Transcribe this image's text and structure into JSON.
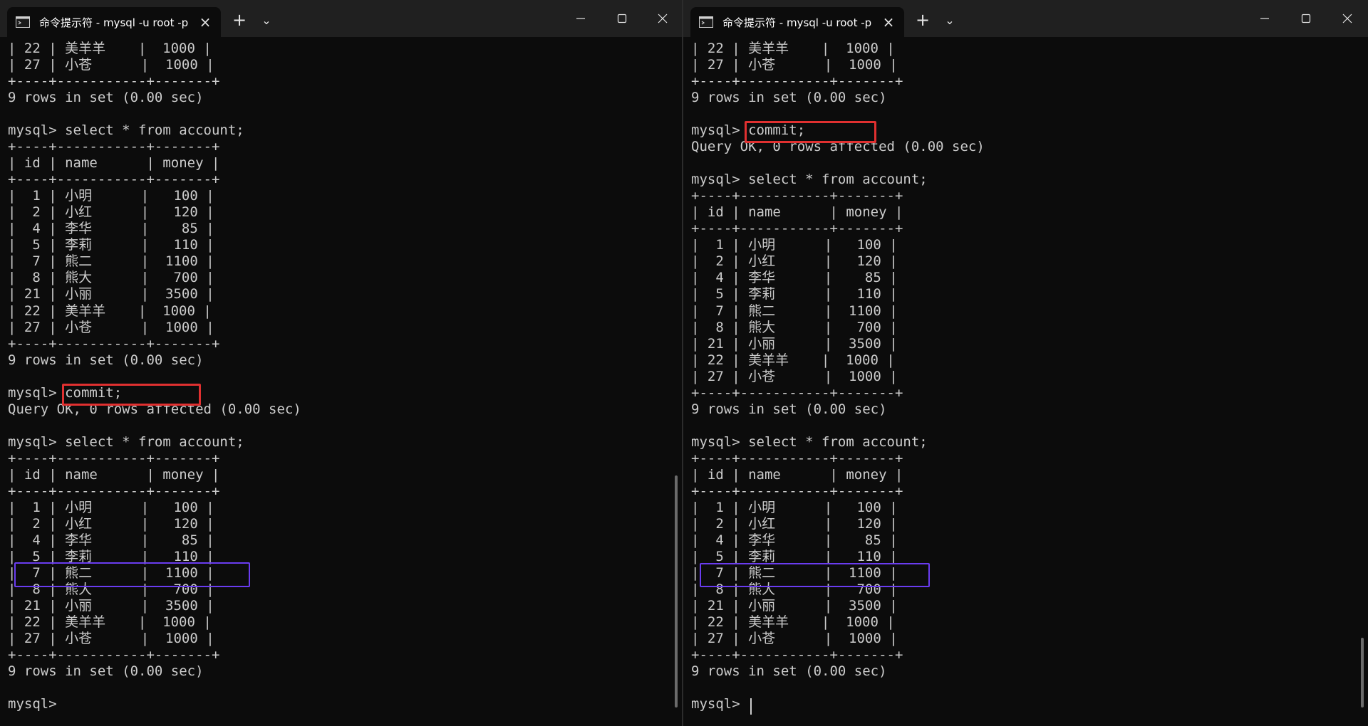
{
  "left": {
    "tab_title": "命令提示符 - mysql  -u root -p",
    "lines": [
      "| 22 | 美羊羊    |  1000 |",
      "| 27 | 小苍      |  1000 |",
      "+----+-----------+-------+",
      "9 rows in set (0.00 sec)",
      "",
      "mysql> select * from account;",
      "+----+-----------+-------+",
      "| id | name      | money |",
      "+----+-----------+-------+",
      "|  1 | 小明      |   100 |",
      "|  2 | 小红      |   120 |",
      "|  4 | 李华      |    85 |",
      "|  5 | 李莉      |   110 |",
      "|  7 | 熊二      |  1100 |",
      "|  8 | 熊大      |   700 |",
      "| 21 | 小丽      |  3500 |",
      "| 22 | 美羊羊    |  1000 |",
      "| 27 | 小苍      |  1000 |",
      "+----+-----------+-------+",
      "9 rows in set (0.00 sec)",
      "",
      "mysql> commit;",
      "Query OK, 0 rows affected (0.00 sec)",
      "",
      "mysql> select * from account;",
      "+----+-----------+-------+",
      "| id | name      | money |",
      "+----+-----------+-------+",
      "|  1 | 小明      |   100 |",
      "|  2 | 小红      |   120 |",
      "|  4 | 李华      |    85 |",
      "|  5 | 李莉      |   110 |",
      "|  7 | 熊二      |  1100 |",
      "|  8 | 熊大      |   700 |",
      "| 21 | 小丽      |  3500 |",
      "| 22 | 美羊羊    |  1000 |",
      "| 27 | 小苍      |  1000 |",
      "+----+-----------+-------+",
      "9 rows in set (0.00 sec)",
      "",
      "mysql> "
    ]
  },
  "right": {
    "tab_title": "命令提示符 - mysql  -u root -p",
    "lines": [
      "| 22 | 美羊羊    |  1000 |",
      "| 27 | 小苍      |  1000 |",
      "+----+-----------+-------+",
      "9 rows in set (0.00 sec)",
      "",
      "mysql> commit;",
      "Query OK, 0 rows affected (0.00 sec)",
      "",
      "mysql> select * from account;",
      "+----+-----------+-------+",
      "| id | name      | money |",
      "+----+-----------+-------+",
      "|  1 | 小明      |   100 |",
      "|  2 | 小红      |   120 |",
      "|  4 | 李华      |    85 |",
      "|  5 | 李莉      |   110 |",
      "|  7 | 熊二      |  1100 |",
      "|  8 | 熊大      |   700 |",
      "| 21 | 小丽      |  3500 |",
      "| 22 | 美羊羊    |  1000 |",
      "| 27 | 小苍      |  1000 |",
      "+----+-----------+-------+",
      "9 rows in set (0.00 sec)",
      "",
      "mysql> select * from account;",
      "+----+-----------+-------+",
      "| id | name      | money |",
      "+----+-----------+-------+",
      "|  1 | 小明      |   100 |",
      "|  2 | 小红      |   120 |",
      "|  4 | 李华      |    85 |",
      "|  5 | 李莉      |   110 |",
      "|  7 | 熊二      |  1100 |",
      "|  8 | 熊大      |   700 |",
      "| 21 | 小丽      |  3500 |",
      "| 22 | 美羊羊    |  1000 |",
      "| 27 | 小苍      |  1000 |",
      "+----+-----------+-------+",
      "9 rows in set (0.00 sec)",
      "",
      "mysql> "
    ]
  },
  "ui": {
    "close_glyph": "×",
    "newtab_glyph": "+",
    "dropdown_glyph": "⌄",
    "highlight_commit_color": "#e03030",
    "highlight_row_color": "#6a3cf0",
    "terminal_bg": "#0c0c0c",
    "titlebar_bg": "#202020",
    "text_color": "#cccccc"
  }
}
